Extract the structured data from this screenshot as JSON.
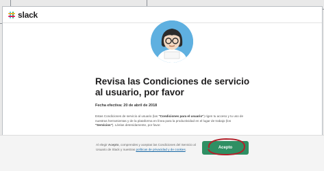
{
  "app": {
    "name": "slack"
  },
  "page": {
    "title": "Revisa las Condiciones de servicio al usuario, por favor",
    "effective_date": "Fecha efectiva: 20 de abril de 2018",
    "body_intro": "Estas Condiciones de servicio al usuario (las ",
    "body_term1": "\"Condiciones para el usuario\"",
    "body_mid": ") rigen tu acceso y tu uso de nuestras herramientas y de la plataforma en línea para la productividad en el lugar de trabajo (los ",
    "body_term2": "\"Servicios\"",
    "body_end": "). Léelas detenidamente, por favor."
  },
  "footer": {
    "text_pre": "Al elegir ",
    "text_bold": "Acepto",
    "text_mid": ", comprendes y aceptas las Condiciones del Servicio al Usuario de Slack y nuestras ",
    "link": "políticas de privacidad y de cookies",
    "text_end": ".",
    "accept_label": "Acepto"
  },
  "colors": {
    "accept": "#2f8f63",
    "annotation": "#b3202a",
    "avatar_bg": "#5fb0e0"
  }
}
